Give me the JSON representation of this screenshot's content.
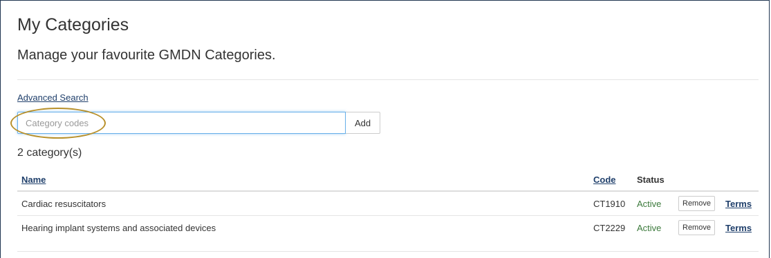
{
  "header": {
    "title": "My Categories",
    "subtitle": "Manage your favourite GMDN Categories."
  },
  "search": {
    "advanced_link": "Advanced Search",
    "placeholder": "Category codes",
    "value": "",
    "add_label": "Add"
  },
  "results": {
    "count_text": "2 category(s)"
  },
  "table": {
    "headers": {
      "name": "Name",
      "code": "Code",
      "status": "Status"
    },
    "rows": [
      {
        "name": "Cardiac resuscitators",
        "code": "CT1910",
        "status": "Active",
        "remove_label": "Remove",
        "terms_label": "Terms"
      },
      {
        "name": "Hearing implant systems and associated devices",
        "code": "CT2229",
        "status": "Active",
        "remove_label": "Remove",
        "terms_label": "Terms"
      }
    ]
  },
  "colors": {
    "link": "#1f3f6b",
    "status_active": "#3c7a3c",
    "highlight": "#b8902a",
    "input_focus_border": "#66afe9"
  }
}
